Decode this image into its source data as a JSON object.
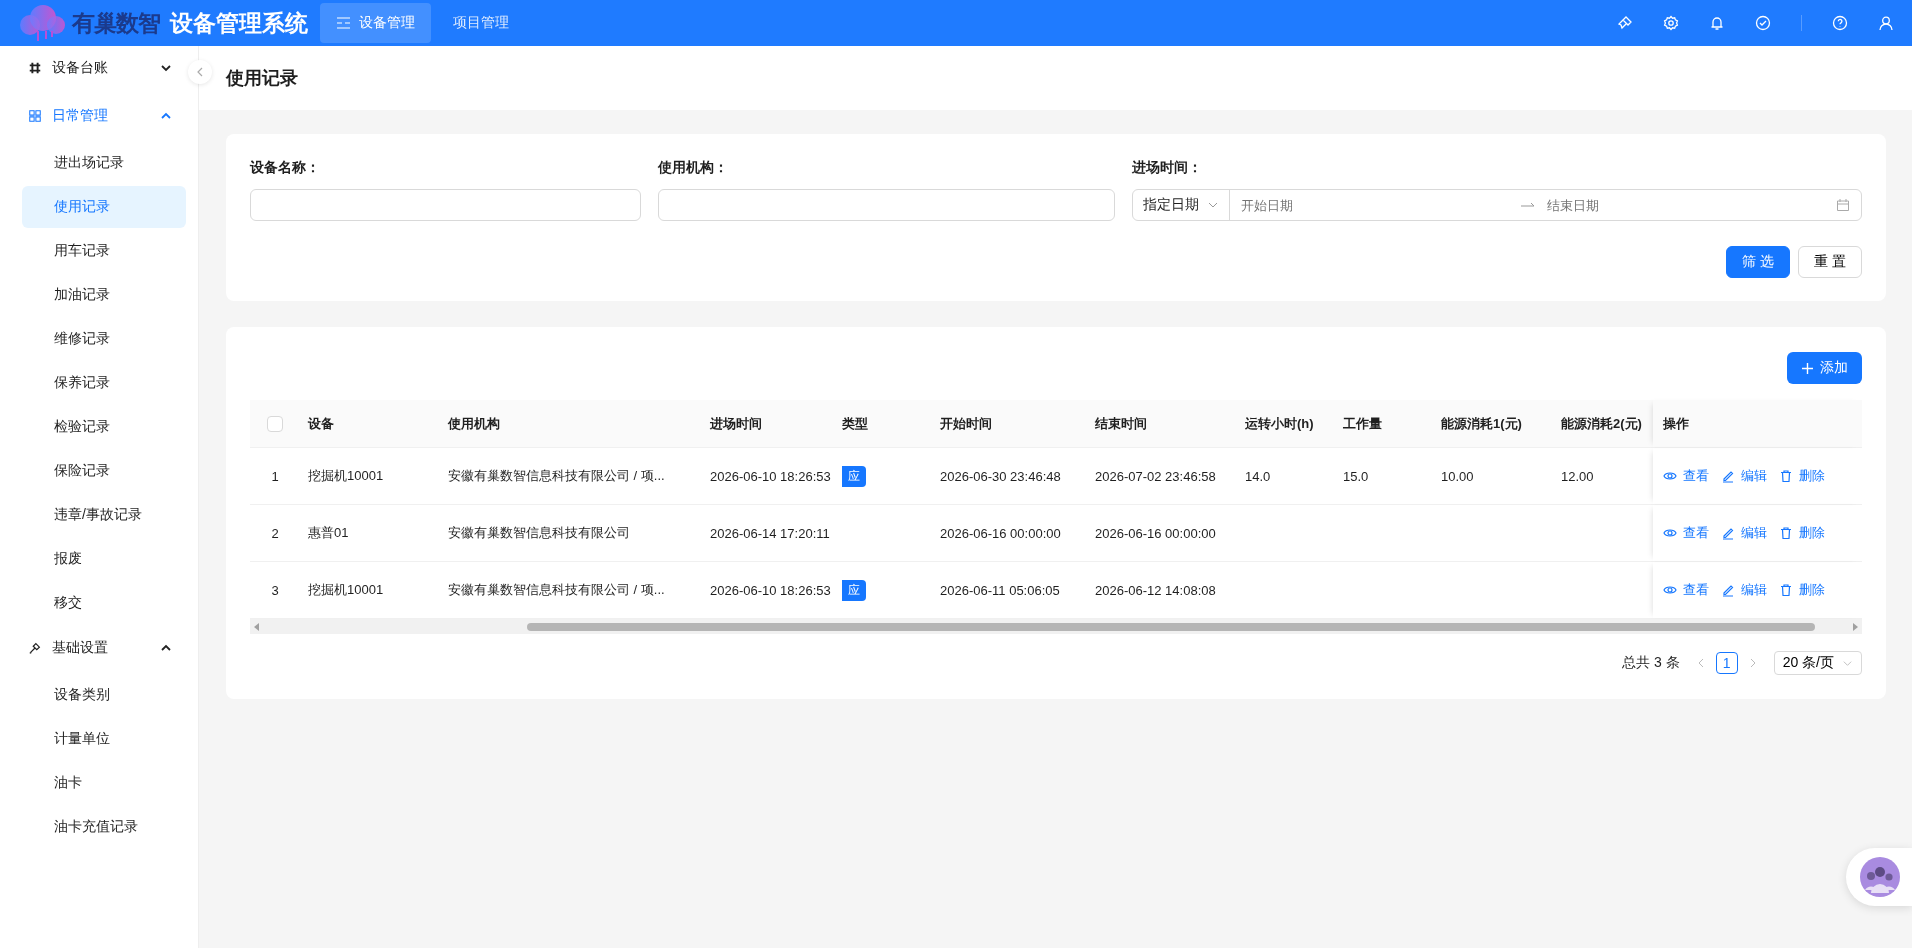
{
  "header": {
    "logo_text": "有巢数智",
    "title": "设备管理系统",
    "nav": [
      {
        "label": "设备管理",
        "selected": true
      },
      {
        "label": "项目管理",
        "selected": false
      }
    ]
  },
  "sidebar": {
    "groups": [
      {
        "label": "设备台账",
        "expanded": false
      },
      {
        "label": "日常管理",
        "expanded": true,
        "children": [
          {
            "label": "进出场记录",
            "selected": false
          },
          {
            "label": "使用记录",
            "selected": true
          },
          {
            "label": "用车记录",
            "selected": false
          },
          {
            "label": "加油记录",
            "selected": false
          },
          {
            "label": "维修记录",
            "selected": false
          },
          {
            "label": "保养记录",
            "selected": false
          },
          {
            "label": "检验记录",
            "selected": false
          },
          {
            "label": "保险记录",
            "selected": false
          },
          {
            "label": "违章/事故记录",
            "selected": false
          },
          {
            "label": "报废",
            "selected": false
          },
          {
            "label": "移交",
            "selected": false
          }
        ]
      },
      {
        "label": "基础设置",
        "expanded": true,
        "children": [
          {
            "label": "设备类别",
            "selected": false
          },
          {
            "label": "计量单位",
            "selected": false
          },
          {
            "label": "油卡",
            "selected": false
          },
          {
            "label": "油卡充值记录",
            "selected": false
          }
        ]
      }
    ]
  },
  "page_title": "使用记录",
  "filters": {
    "fields": [
      {
        "label": "设备名称：",
        "kind": "text"
      },
      {
        "label": "使用机构：",
        "kind": "text"
      },
      {
        "label": "进场时间：",
        "kind": "daterange",
        "mode": "指定日期",
        "start_placeholder": "开始日期",
        "end_placeholder": "结束日期"
      }
    ],
    "buttons": [
      {
        "label": "筛 选",
        "kind": "primary"
      },
      {
        "label": "重 置",
        "kind": "default"
      }
    ]
  },
  "table": {
    "add_button": "添加",
    "header_checkbox": {
      "checked": false
    },
    "columns": [
      {
        "label": "设备",
        "kind": "text"
      },
      {
        "label": "使用机构",
        "kind": "text"
      },
      {
        "label": "进场时间",
        "kind": "text"
      },
      {
        "label": "类型",
        "kind": "tag"
      },
      {
        "label": "开始时间",
        "kind": "text"
      },
      {
        "label": "结束时间",
        "kind": "text"
      },
      {
        "label": "运转小时(h)",
        "kind": "text"
      },
      {
        "label": "工作量",
        "kind": "text"
      },
      {
        "label": "能源消耗1(元)",
        "kind": "text"
      },
      {
        "label": "能源消耗2(元)",
        "kind": "text"
      },
      {
        "label": "操作",
        "kind": "actions"
      }
    ],
    "rows": [
      {
        "index": "1",
        "cells": [
          "挖掘机10001",
          "安徽有巢数智信息科技有限公司 / 项...",
          "2026-06-10 18:26:53",
          "应",
          "2026-06-30 23:46:48",
          "2026-07-02 23:46:58",
          "14.0",
          "15.0",
          "10.00",
          "12.00",
          [
            {
              "label": "查看",
              "kind": "view"
            },
            {
              "label": "编辑",
              "kind": "edit"
            },
            {
              "label": "删除",
              "kind": "delete"
            }
          ]
        ]
      },
      {
        "index": "2",
        "cells": [
          "惠普01",
          "安徽有巢数智信息科技有限公司",
          "2026-06-14 17:20:11",
          null,
          "2026-06-16 00:00:00",
          "2026-06-16 00:00:00",
          null,
          null,
          null,
          null,
          [
            {
              "label": "查看",
              "kind": "view"
            },
            {
              "label": "编辑",
              "kind": "edit"
            },
            {
              "label": "删除",
              "kind": "delete"
            }
          ]
        ]
      },
      {
        "index": "3",
        "cells": [
          "挖掘机10001",
          "安徽有巢数智信息科技有限公司 / 项...",
          "2026-06-10 18:26:53",
          "应",
          "2026-06-11 05:06:05",
          "2026-06-12 14:08:08",
          null,
          null,
          null,
          null,
          [
            {
              "label": "查看",
              "kind": "view"
            },
            {
              "label": "编辑",
              "kind": "edit"
            },
            {
              "label": "删除",
              "kind": "delete"
            }
          ]
        ]
      }
    ]
  },
  "pagination": {
    "total": "总共 3 条",
    "pages": [
      {
        "label": "1",
        "selected": true
      }
    ],
    "page_size": "20 条/页"
  }
}
